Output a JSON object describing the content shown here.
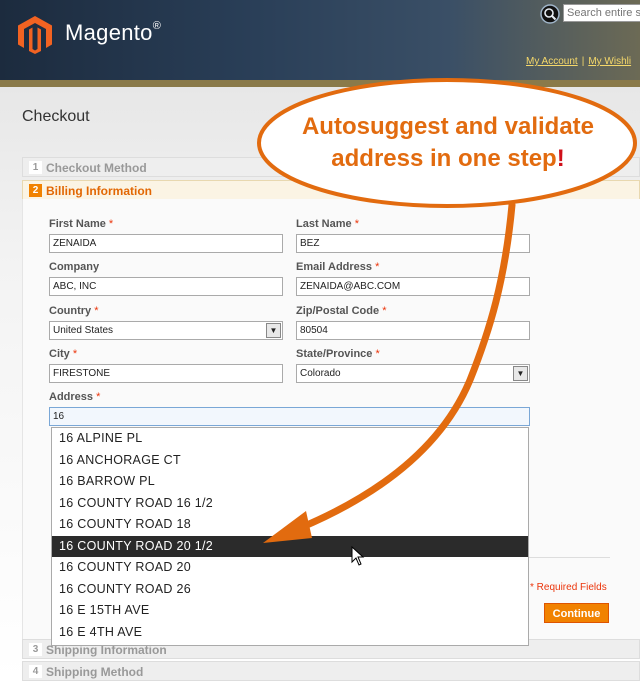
{
  "header": {
    "brand": "Magento",
    "brand_mark": "®",
    "search_placeholder": "Search entire s",
    "links": [
      "My Account",
      "My Wishli"
    ],
    "link_separator": "|"
  },
  "page": {
    "title": "Checkout"
  },
  "steps": [
    {
      "num": "1",
      "label": "Checkout Method",
      "active": false
    },
    {
      "num": "2",
      "label": "Billing Information",
      "active": true
    },
    {
      "num": "3",
      "label": "Shipping Information",
      "active": false
    },
    {
      "num": "4",
      "label": "Shipping Method",
      "active": false
    }
  ],
  "form": {
    "required_mark": "*",
    "first_name": {
      "label": "First Name",
      "value": "ZENAIDA"
    },
    "last_name": {
      "label": "Last Name",
      "value": "BEZ"
    },
    "company": {
      "label": "Company",
      "value": "ABC, INC"
    },
    "email": {
      "label": "Email Address",
      "value": "ZENAIDA@ABC.COM"
    },
    "country": {
      "label": "Country",
      "value": "United States"
    },
    "zip": {
      "label": "Zip/Postal Code",
      "value": "80504"
    },
    "city": {
      "label": "City",
      "value": "FIRESTONE"
    },
    "state": {
      "label": "State/Province",
      "value": "Colorado"
    },
    "address": {
      "label": "Address",
      "value": "16"
    },
    "required_note": "* Required Fields",
    "continue_label": "Continue"
  },
  "autosuggest": {
    "items": [
      "16 ALPINE PL",
      "16 ANCHORAGE CT",
      "16 BARROW PL",
      "16 COUNTY ROAD 16 1/2",
      "16 COUNTY ROAD 18",
      "16 COUNTY ROAD 20 1/2",
      "16 COUNTY ROAD 20",
      "16 COUNTY ROAD 26",
      "16 E 15TH AVE",
      "16 E 4TH AVE"
    ],
    "selected_index": 5
  },
  "callout": {
    "line1": "Autosuggest and validate",
    "line2": "address in one step",
    "bang": "!",
    "fill": "#ffffff",
    "stroke": "#e26b0f",
    "arrow_color": "#e26b0f"
  },
  "colors": {
    "accent": "#f18200",
    "required": "#eb340a"
  }
}
